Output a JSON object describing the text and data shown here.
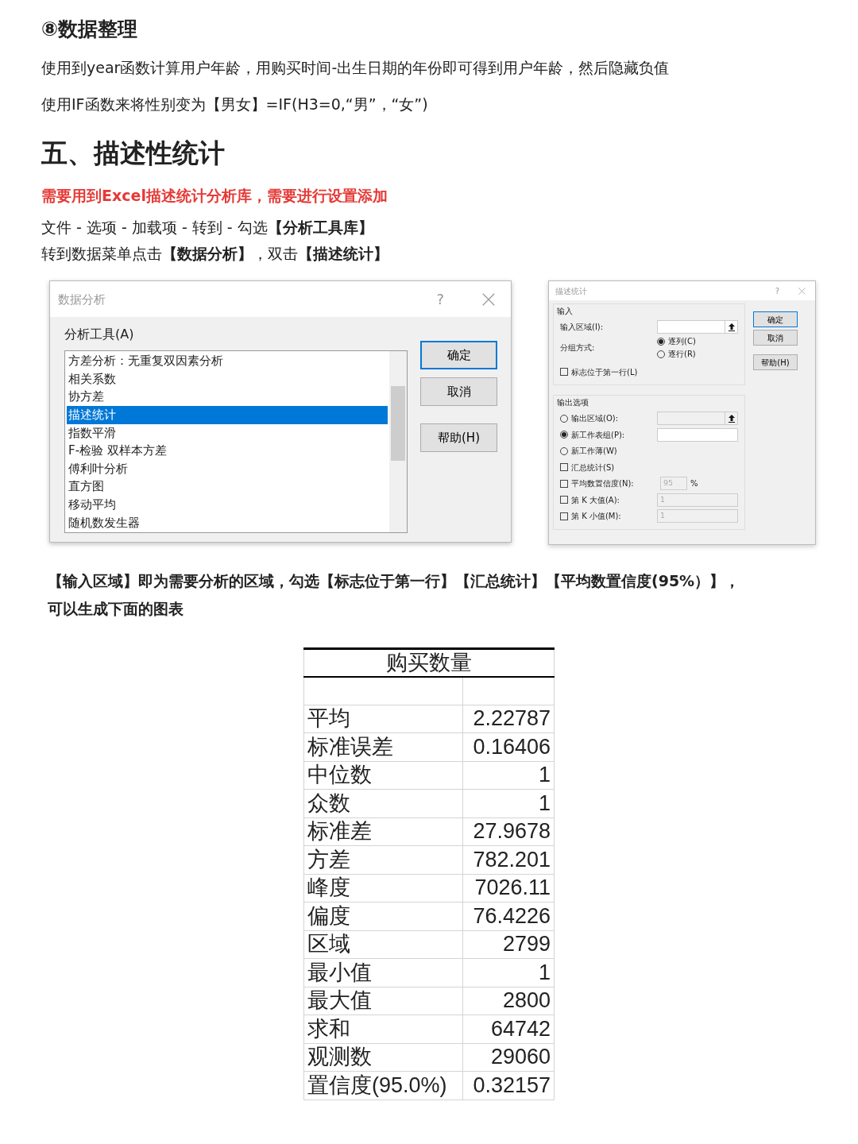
{
  "section_title": "⑧数据整理",
  "paragraphs": [
    "使用到year函数计算用户年龄，用购买时间-出生日期的年份即可得到用户年龄，然后隐藏负值",
    "使用IF函数来将性别变为【男女】=IF(H3=0,“男”，“女”)"
  ],
  "heading": "五、描述性统计",
  "notice": "需要用到Excel描述统计分析库，需要进行设置添加",
  "steps": [
    "文件 - 选项 - 加载项 - 转到 - 勾选**【分析工具库】**",
    "转到数据菜单点击**【数据分析】**，双击**【描述统计】**"
  ],
  "dialog_analysis": {
    "title": "数据分析",
    "help": "?",
    "list_label": "分析工具(A)",
    "items": [
      {
        "label": "方差分析：无重复双因素分析",
        "selected": false
      },
      {
        "label": "相关系数",
        "selected": false
      },
      {
        "label": "协方差",
        "selected": false
      },
      {
        "label": "描述统计",
        "selected": true
      },
      {
        "label": "指数平滑",
        "selected": false
      },
      {
        "label": "F-检验 双样本方差",
        "selected": false
      },
      {
        "label": "傅利叶分析",
        "selected": false
      },
      {
        "label": "直方图",
        "selected": false
      },
      {
        "label": "移动平均",
        "selected": false
      },
      {
        "label": "随机数发生器",
        "selected": false
      }
    ],
    "buttons": [
      {
        "label": "确定",
        "default": true
      },
      {
        "label": "取消",
        "default": false
      },
      {
        "label": "帮助(H)",
        "default": false
      }
    ]
  },
  "dialog_descriptive": {
    "title": "描述统计",
    "help": "?",
    "groups": [
      {
        "title": "输入",
        "rows": [
          {
            "kind": "text",
            "label": "输入区域(I):",
            "field": {
              "disabled": false,
              "picker": true
            }
          },
          {
            "kind": "radio",
            "label": "分组方式:",
            "options": [
              {
                "label": "逐列(C)",
                "selected": true
              },
              {
                "label": "逐行(R)",
                "selected": false
              }
            ]
          },
          {
            "kind": "checkbox",
            "label": "标志位于第一行(L)",
            "checked": false
          }
        ]
      },
      {
        "title": "输出选项",
        "rows": [
          {
            "kind": "option",
            "label": "输出区域(O):",
            "selected": false,
            "field": {
              "disabled": true,
              "picker": true
            }
          },
          {
            "kind": "option",
            "label": "新工作表组(P):",
            "selected": true,
            "field": {
              "disabled": false,
              "picker": false
            }
          },
          {
            "kind": "option",
            "label": "新工作薄(W)",
            "selected": false
          },
          {
            "kind": "checkbox",
            "label": "汇总统计(S)",
            "checked": false
          },
          {
            "kind": "checkbox",
            "label": "平均数置信度(N):",
            "checked": false,
            "field": {
              "value": "95",
              "disabled": true,
              "picker": false,
              "short": true
            },
            "unit": "%"
          },
          {
            "kind": "checkbox",
            "label": "第 K 大值(A):",
            "checked": false,
            "field": {
              "value": "1",
              "disabled": true,
              "picker": false
            }
          },
          {
            "kind": "checkbox",
            "label": "第 K 小值(M):",
            "checked": false,
            "field": {
              "value": "1",
              "disabled": true,
              "picker": false
            }
          }
        ]
      }
    ],
    "buttons": [
      {
        "label": "确定",
        "default": true
      },
      {
        "label": "取消",
        "default": false
      },
      {
        "label": "帮助(H)",
        "default": false
      }
    ]
  },
  "caption": "【输入区域】即为需要分析的区域，勾选【标志位于第一行】【汇总统计】【平均数置信度(95%）】，可以生成下面的图表",
  "stats_table": {
    "header": "购买数量",
    "rows": [
      [
        "平均",
        "2.22787"
      ],
      [
        "标准误差",
        "0.16406"
      ],
      [
        "中位数",
        "1"
      ],
      [
        "众数",
        "1"
      ],
      [
        "标准差",
        "27.9678"
      ],
      [
        "方差",
        "782.201"
      ],
      [
        "峰度",
        "7026.11"
      ],
      [
        "偏度",
        "76.4226"
      ],
      [
        "区域",
        "2799"
      ],
      [
        "最小值",
        "1"
      ],
      [
        "最大值",
        "2800"
      ],
      [
        "求和",
        "64742"
      ],
      [
        "观测数",
        "29060"
      ],
      [
        "置信度(95.0%)",
        "0.32157"
      ]
    ]
  }
}
